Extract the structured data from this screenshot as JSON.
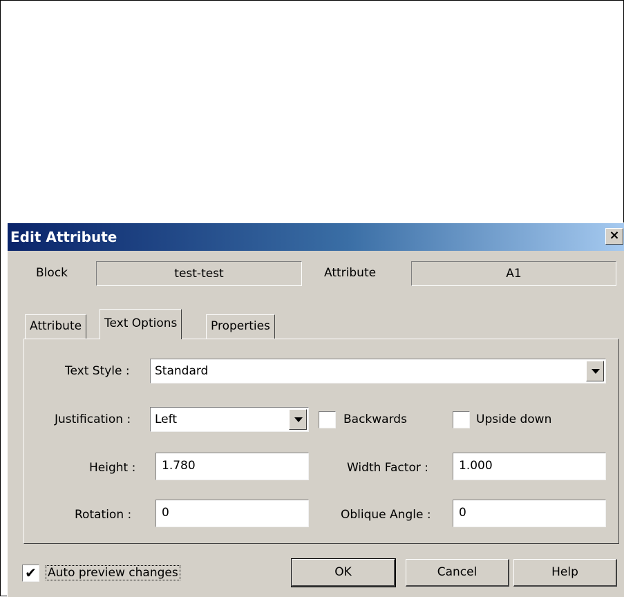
{
  "dialog": {
    "title": "Edit Attribute",
    "close_glyph": "×"
  },
  "header": {
    "block_label": "Block",
    "block_value": "test-test",
    "attribute_label": "Attribute",
    "attribute_value": "A1"
  },
  "tabs": [
    {
      "label": "Attribute",
      "active": false
    },
    {
      "label": "Text Options",
      "active": true
    },
    {
      "label": "Properties",
      "active": false
    }
  ],
  "text_options": {
    "text_style_label": "Text Style :",
    "text_style_value": "Standard",
    "justification_label": "Justification :",
    "justification_value": "Left",
    "backwards_label": "Backwards",
    "backwards_checked": false,
    "upside_down_label": "Upside down",
    "upside_down_checked": false,
    "height_label": "Height :",
    "height_value": "1.780",
    "width_factor_label": "Width Factor :",
    "width_factor_value": "1.000",
    "rotation_label": "Rotation :",
    "rotation_value": "0",
    "oblique_angle_label": "Oblique Angle :",
    "oblique_angle_value": "0"
  },
  "footer": {
    "auto_preview_label": "Auto preview changes",
    "auto_preview_checked": true,
    "check_glyph": "✔",
    "ok_label": "OK",
    "cancel_label": "Cancel",
    "help_label": "Help"
  }
}
